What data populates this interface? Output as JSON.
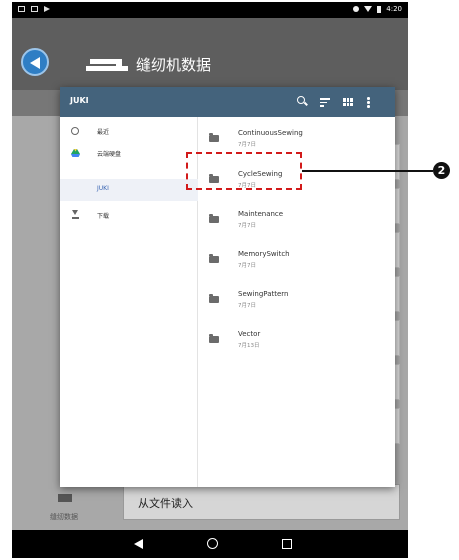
{
  "status_bar": {
    "time": "4:20"
  },
  "app": {
    "title": "缝纫机数据"
  },
  "picker": {
    "title": "JUKI",
    "toolbar_icons": [
      "search-icon",
      "sort-icon",
      "grid-view-icon",
      "more-vert-icon"
    ],
    "drawer_items": [
      {
        "label": "最近",
        "icon": "clock-icon"
      },
      {
        "label": "云端硬盘",
        "icon": "drive-icon"
      },
      {
        "label": "JUKI",
        "icon": "",
        "selected": true
      },
      {
        "label": "下载",
        "icon": "download-icon"
      }
    ],
    "files": [
      {
        "name": "ContinuousSewing",
        "date": "7月7日"
      },
      {
        "name": "CycleSewing",
        "date": "7月7日"
      },
      {
        "name": "Maintenance",
        "date": "7月7日"
      },
      {
        "name": "MemorySwitch",
        "date": "7月7日"
      },
      {
        "name": "SewingPattern",
        "date": "7月7日"
      },
      {
        "name": "Vector",
        "date": "7月13日"
      }
    ]
  },
  "bottom": {
    "icon_label": "缝纫数据",
    "read_button": "从文件读入"
  },
  "annotation": {
    "callout": "2"
  },
  "colors": {
    "toolbar": "#44637c",
    "accent": "#2f7ec4",
    "highlight": "#d21a1a"
  }
}
